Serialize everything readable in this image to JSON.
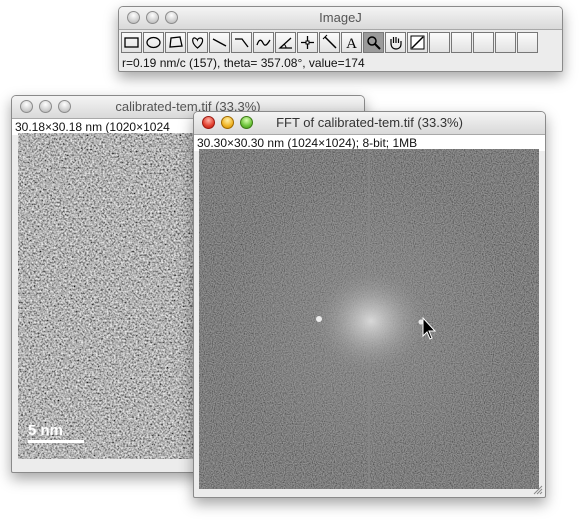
{
  "imagej": {
    "title": "ImageJ",
    "tools": [
      {
        "name": "rectangle-tool-icon",
        "active": false
      },
      {
        "name": "oval-tool-icon",
        "active": false
      },
      {
        "name": "polygon-tool-icon",
        "active": false
      },
      {
        "name": "freehand-tool-icon",
        "active": false
      },
      {
        "name": "straight-line-tool-icon",
        "active": false
      },
      {
        "name": "segmented-line-tool-icon",
        "active": false
      },
      {
        "name": "freehand-line-tool-icon",
        "active": false
      },
      {
        "name": "angle-tool-icon",
        "active": false
      },
      {
        "name": "point-tool-icon",
        "active": false
      },
      {
        "name": "wand-tool-icon",
        "active": false
      },
      {
        "name": "text-tool-icon",
        "active": false
      },
      {
        "name": "magnifier-tool-icon",
        "active": true
      },
      {
        "name": "hand-tool-icon",
        "active": false
      },
      {
        "name": "color-picker-tool-icon",
        "active": false
      },
      {
        "name": "empty-tool-slot",
        "active": false
      },
      {
        "name": "empty-tool-slot",
        "active": false
      },
      {
        "name": "empty-tool-slot",
        "active": false
      },
      {
        "name": "empty-tool-slot",
        "active": false
      },
      {
        "name": "empty-tool-slot",
        "active": false
      }
    ],
    "status": "r=0.19 nm/c (157), theta= 357.08°, value=174"
  },
  "tem_window": {
    "title": "calibrated-tem.tif (33.3%)",
    "info": "30.18×30.18 nm (1020×1024",
    "scale_label": "5 nm"
  },
  "fft_window": {
    "title": "FFT of calibrated-tem.tif (33.3%)",
    "info": "30.30×30.30 nm (1024×1024); 8-bit; 1MB"
  },
  "colors": {
    "active_tool": "#9a9a9a",
    "fft_background": "#505050",
    "tem_background": "#7c7c7c"
  }
}
